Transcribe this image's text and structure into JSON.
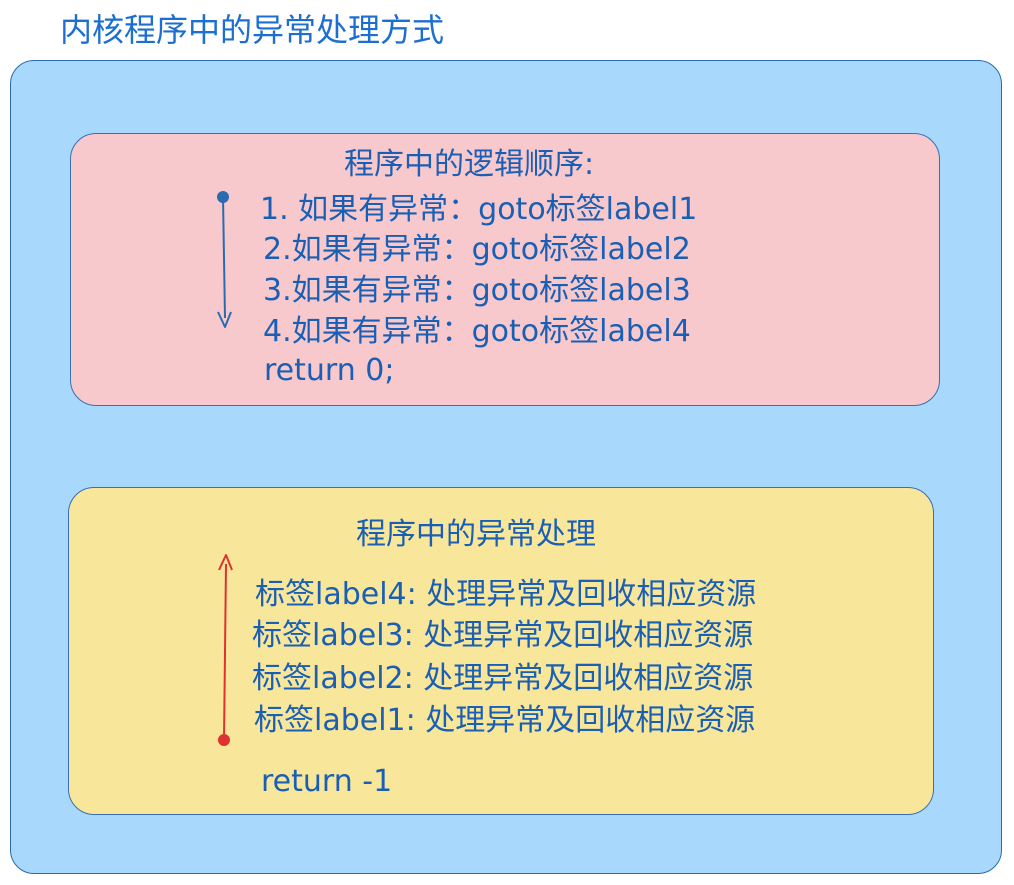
{
  "title": "内核程序中的异常处理方式",
  "logic_panel": {
    "heading": "程序中的逻辑顺序:",
    "lines": [
      "1. 如果有异常：goto标签label1",
      "2.如果有异常：goto标签label2",
      "3.如果有异常：goto标签label3",
      "4.如果有异常：goto标签label4",
      "return 0;"
    ]
  },
  "handler_panel": {
    "heading": "程序中的异常处理",
    "lines": [
      "标签label4: 处理异常及回收相应资源",
      "标签label3: 处理异常及回收相应资源",
      "标签label2: 处理异常及回收相应资源",
      "标签label1: 处理异常及回收相应资源"
    ],
    "return_line": "return -1"
  },
  "colors": {
    "outer_bg": "#a8d8fb",
    "logic_bg": "#f8c9cc",
    "handler_bg": "#f8e79a",
    "text": "#1a5fb4",
    "down_arrow": "#2a6bb0",
    "up_arrow": "#e03030"
  }
}
